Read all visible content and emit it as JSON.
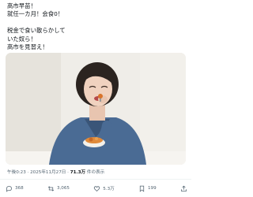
{
  "post": {
    "text": "高市早苗！\n就任一カ月！会食0！\n\n税金で食い散らかして\nいた奴ら！\n高市を見習え！"
  },
  "photo": {
    "bg_color": "#efede8",
    "jacket_color": "#4a6b94",
    "hair_color": "#2b2420"
  },
  "meta": {
    "time": "午後0:23",
    "sep1": " · ",
    "date": "2025年11月27日",
    "sep2": " · ",
    "views_count": "71.3万",
    "views_label": " 件の表示"
  },
  "actions": {
    "reply_count": "368",
    "repost_count": "3,065",
    "like_count": "5.3万",
    "bookmark_count": "199"
  },
  "icons": {
    "reply": "reply-icon",
    "repost": "repost-icon",
    "like": "heart-icon",
    "bookmark": "bookmark-icon",
    "share": "share-icon"
  },
  "colors": {
    "text": "#0f1419",
    "secondary": "#536471"
  }
}
